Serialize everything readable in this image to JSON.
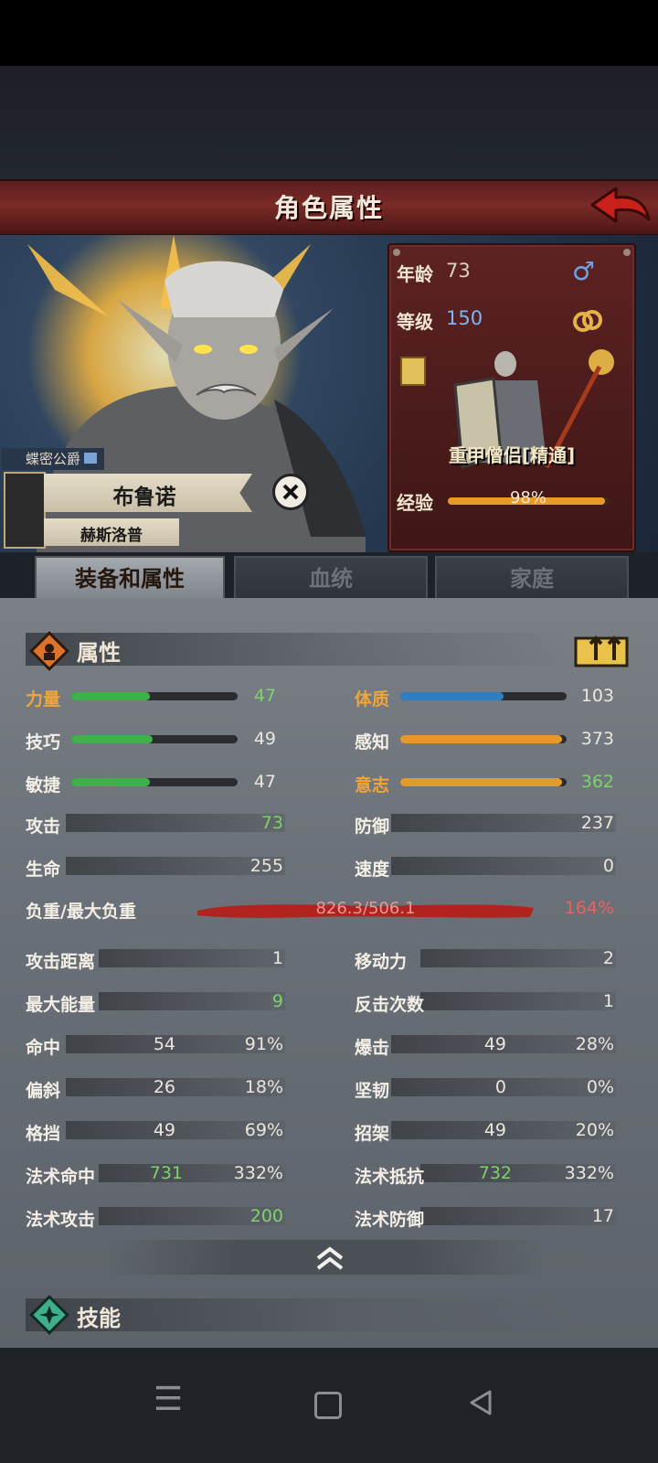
{
  "screen": {
    "title": "角色属性"
  },
  "character": {
    "age_label": "年龄",
    "age": "73",
    "gender_icon": "♂",
    "level_label": "等级",
    "level": "150",
    "class_name": "重甲僧侣[精通]",
    "exp_label": "经验",
    "exp_percent": "98%",
    "exp_fraction": 0.98,
    "rank_title": "蝶密公爵",
    "name": "布鲁诺",
    "family_name": "赫斯洛普"
  },
  "tabs": [
    {
      "label": "装备和属性",
      "active": true
    },
    {
      "label": "血统",
      "active": false
    },
    {
      "label": "家庭",
      "active": false
    }
  ],
  "attributes": {
    "section_title": "属性",
    "left": [
      {
        "label": "力量",
        "value": "47",
        "fill": 0.47,
        "color": "#3fb04a",
        "label_orange": true,
        "value_green": true
      },
      {
        "label": "技巧",
        "value": "49",
        "fill": 0.49,
        "color": "#3fb04a",
        "label_orange": false,
        "value_green": false
      },
      {
        "label": "敏捷",
        "value": "47",
        "fill": 0.47,
        "color": "#3fb04a",
        "label_orange": false,
        "value_green": false
      }
    ],
    "right": [
      {
        "label": "体质",
        "value": "103",
        "fill": 0.62,
        "color": "#2f7fc0",
        "label_orange": true,
        "value_green": false
      },
      {
        "label": "感知",
        "value": "373",
        "fill": 0.97,
        "color": "#e39a2a",
        "label_orange": false,
        "value_green": false
      },
      {
        "label": "意志",
        "value": "362",
        "fill": 0.97,
        "color": "#e39a2a",
        "label_orange": true,
        "value_green": true
      }
    ]
  },
  "stats": {
    "attack_label": "攻击",
    "attack": "73",
    "defense_label": "防御",
    "defense": "237",
    "hp_label": "生命",
    "hp": "255",
    "speed_label": "速度",
    "speed": "0",
    "load_label": "负重/最大负重",
    "load": "826.3/506.1",
    "load_percent": "164%",
    "range_label": "攻击距离",
    "range": "1",
    "move_label": "移动力",
    "move": "2",
    "energy_label": "最大能量",
    "energy": "9",
    "counter_label": "反击次数",
    "counter": "1",
    "hit_label": "命中",
    "hit": "54",
    "hit_pct": "91%",
    "crit_label": "爆击",
    "crit": "49",
    "crit_pct": "28%",
    "deflect_label": "偏斜",
    "deflect": "26",
    "deflect_pct": "18%",
    "tough_label": "坚韧",
    "tough": "0",
    "tough_pct": "0%",
    "block_label": "格挡",
    "block": "49",
    "block_pct": "69%",
    "parry_label": "招架",
    "parry": "49",
    "parry_pct": "20%",
    "spellhit_label": "法术命中",
    "spellhit": "731",
    "spellhit_pct": "332%",
    "spellres_label": "法术抵抗",
    "spellres": "732",
    "spellres_pct": "332%",
    "spellatk_label": "法术攻击",
    "spellatk": "200",
    "spelldef_label": "法术防御",
    "spelldef": "17"
  },
  "skills": {
    "section_title": "技能"
  },
  "icons": {
    "back": "back-arrow-icon",
    "gender": "male-icon",
    "rings": "rings-icon",
    "close": "close-icon",
    "collapse": "chevron-up-double-icon",
    "nav_menu": "menu-icon",
    "nav_home": "square-home-icon",
    "nav_back": "triangle-back-icon"
  },
  "colors": {
    "title_bar": "#7a2a26",
    "level_value": "#7fb4f0",
    "good_value": "#7dd36a",
    "warn_label": "#f0a43c",
    "overload": "#e0524c"
  }
}
